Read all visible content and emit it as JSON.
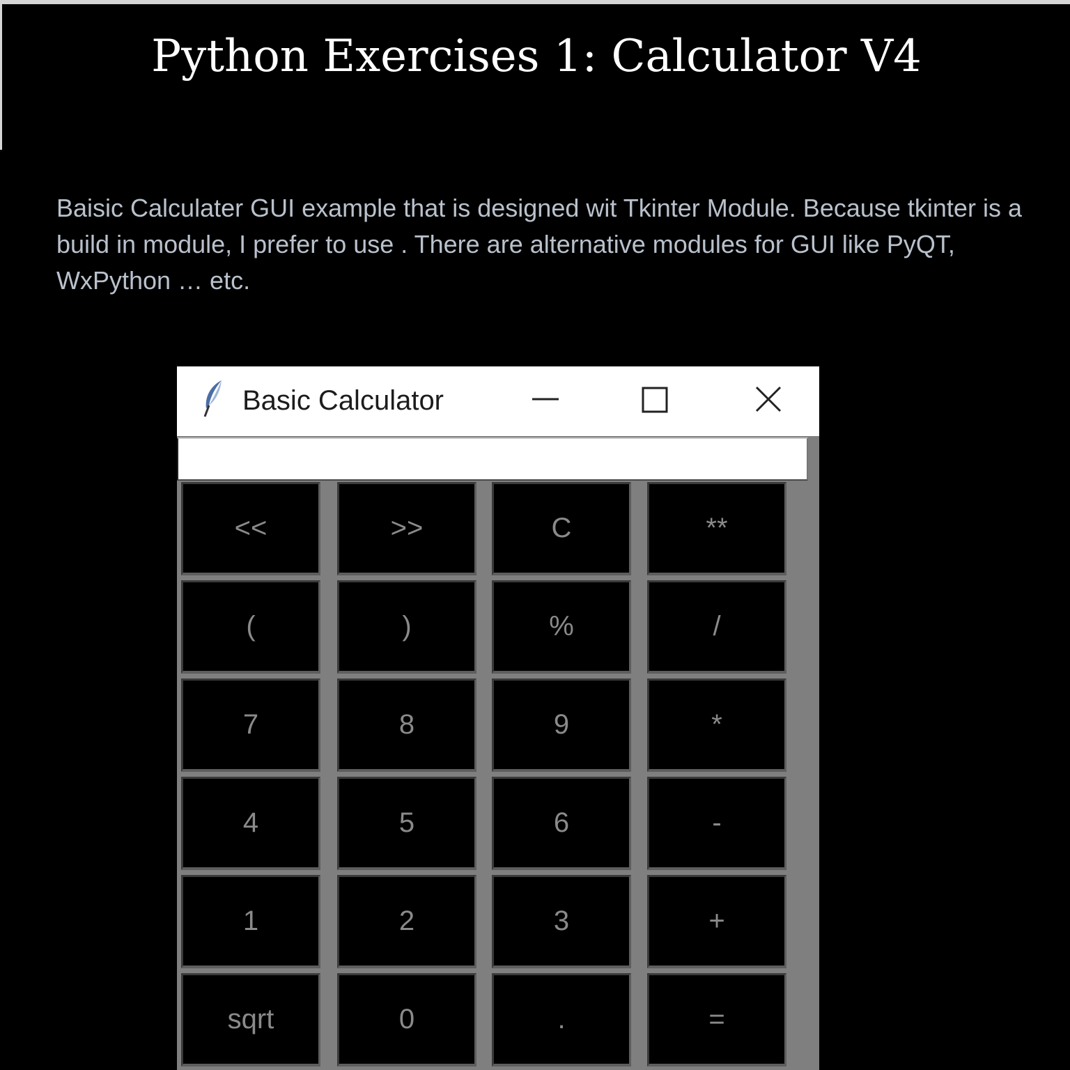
{
  "page": {
    "title": "Python Exercises 1: Calculator V4",
    "description": "Baisic Calculater GUI example that is designed wit Tkinter Module. Because tkinter is a build in module, I prefer to use . There are alternative modules for GUI like PyQT, WxPython … etc."
  },
  "window": {
    "title": "Basic Calculator",
    "icon": "feather-icon",
    "controls": {
      "minimize": "minimize-icon",
      "maximize": "maximize-icon",
      "close": "close-icon"
    }
  },
  "display": {
    "value": ""
  },
  "keypad": {
    "rows": [
      [
        "<<",
        ">>",
        "C",
        "**"
      ],
      [
        "(",
        ")",
        "%",
        "/"
      ],
      [
        "7",
        "8",
        "9",
        "*"
      ],
      [
        "4",
        "5",
        "6",
        "-"
      ],
      [
        "1",
        "2",
        "3",
        "+"
      ],
      [
        "sqrt",
        "0",
        ".",
        "="
      ]
    ],
    "key_names": [
      [
        "backspace-left-key",
        "shift-right-key",
        "clear-key",
        "power-key"
      ],
      [
        "open-paren-key",
        "close-paren-key",
        "modulo-key",
        "divide-key"
      ],
      [
        "digit-7-key",
        "digit-8-key",
        "digit-9-key",
        "multiply-key"
      ],
      [
        "digit-4-key",
        "digit-5-key",
        "digit-6-key",
        "subtract-key"
      ],
      [
        "digit-1-key",
        "digit-2-key",
        "digit-3-key",
        "add-key"
      ],
      [
        "sqrt-key",
        "digit-0-key",
        "decimal-point-key",
        "equals-key"
      ]
    ]
  },
  "colors": {
    "page_background": "#000000",
    "title_text": "#ffffff",
    "description_text": "#b9c1cc",
    "window_frame": "#7f7f7f",
    "key_background": "#000000",
    "key_text": "#8a8a8a",
    "titlebar_background": "#ffffff"
  }
}
